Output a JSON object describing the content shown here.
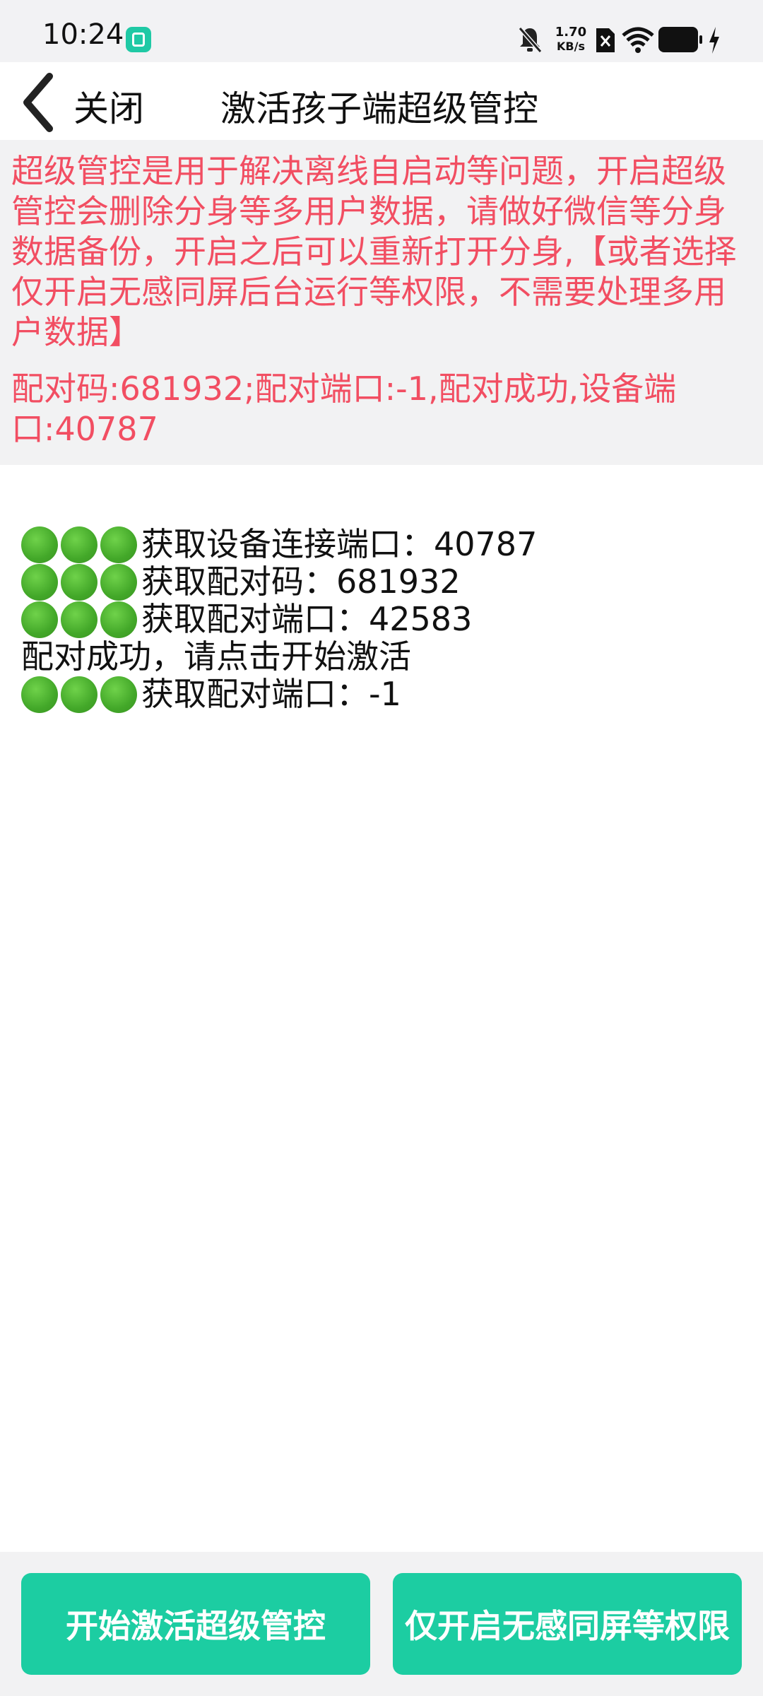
{
  "status": {
    "time": "10:24",
    "speed_top": "1.70",
    "speed_bottom": "KB/s"
  },
  "header": {
    "back_label": "关闭",
    "title": "激活孩子端超级管控"
  },
  "notice": {
    "warning": "超级管控是用于解决离线自启动等问题，开启超级管控会删除分身等多用户数据，请做好微信等分身数据备份，开启之后可以重新打开分身,【或者选择仅开启无感同屏后台运行等权限，不需要处理多用户数据】",
    "pair_status": "配对码:681932;配对端口:-1,配对成功,设备端口:40787"
  },
  "log": [
    {
      "dots": true,
      "text": "获取设备连接端口：40787"
    },
    {
      "dots": true,
      "text": "获取配对码：681932"
    },
    {
      "dots": true,
      "text": "获取配对端口：42583"
    },
    {
      "dots": false,
      "text": "配对成功，请点击开始激活"
    },
    {
      "dots": true,
      "text": "获取配对端口：-1"
    }
  ],
  "buttons": {
    "activate": "开始激活超级管控",
    "permissions_only": "仅开启无感同屏等权限"
  },
  "colors": {
    "accent": "#1ccda2",
    "warning_text": "#f24e62"
  }
}
